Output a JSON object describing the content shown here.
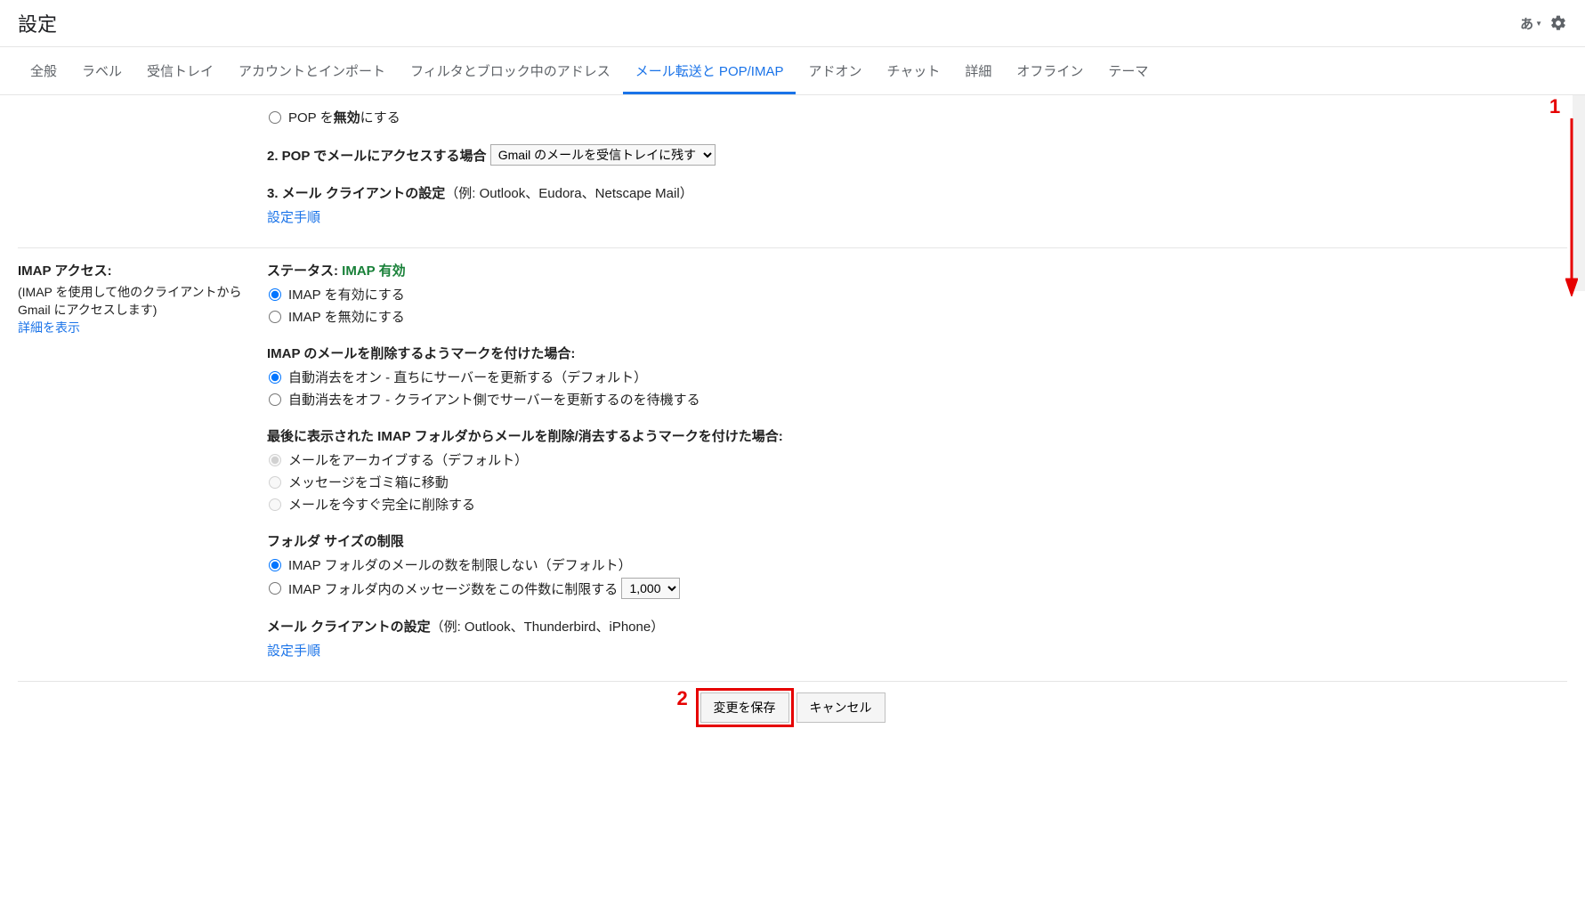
{
  "header": {
    "title": "設定",
    "language_label": "あ"
  },
  "tabs": [
    {
      "label": "全般",
      "active": false
    },
    {
      "label": "ラベル",
      "active": false
    },
    {
      "label": "受信トレイ",
      "active": false
    },
    {
      "label": "アカウントとインポート",
      "active": false
    },
    {
      "label": "フィルタとブロック中のアドレス",
      "active": false
    },
    {
      "label": "メール転送と POP/IMAP",
      "active": true
    },
    {
      "label": "アドオン",
      "active": false
    },
    {
      "label": "チャット",
      "active": false
    },
    {
      "label": "詳細",
      "active": false
    },
    {
      "label": "オフライン",
      "active": false
    },
    {
      "label": "テーマ",
      "active": false
    }
  ],
  "pop": {
    "disable_prefix": "POP を",
    "disable_bold": "無効",
    "disable_suffix": "にする",
    "step2_label": "2. POP でメールにアクセスする場合",
    "step2_select": "Gmail のメールを受信トレイに残す",
    "step3_label": "3. メール クライアントの設定",
    "step3_example": "（例: Outlook、Eudora、Netscape Mail）",
    "setup_link": "設定手順"
  },
  "imap": {
    "left_title": "IMAP アクセス:",
    "left_desc": "(IMAP を使用して他のクライアントから Gmail にアクセスします)",
    "left_link": "詳細を表示",
    "status_label": "ステータス:",
    "status_value": "IMAP 有効",
    "enable_label": "IMAP を有効にする",
    "disable_label": "IMAP を無効にする",
    "delete_mark_title": "IMAP のメールを削除するようマークを付けた場合:",
    "auto_expunge_on": "自動消去をオン - 直ちにサーバーを更新する（デフォルト）",
    "auto_expunge_off": "自動消去をオフ - クライアント側でサーバーを更新するのを待機する",
    "last_folder_title": "最後に表示された IMAP フォルダからメールを削除/消去するようマークを付けた場合:",
    "archive_label": "メールをアーカイブする（デフォルト）",
    "trash_label": "メッセージをゴミ箱に移動",
    "delete_now_label": "メールを今すぐ完全に削除する",
    "folder_size_title": "フォルダ サイズの制限",
    "folder_no_limit": "IMAP フォルダのメールの数を制限しない（デフォルト）",
    "folder_limit_prefix": "IMAP フォルダ内のメッセージ数をこの件数に制限する",
    "folder_limit_value": "1,000",
    "client_setup_label": "メール クライアントの設定",
    "client_setup_example": "（例: Outlook、Thunderbird、iPhone）",
    "setup_link": "設定手順"
  },
  "buttons": {
    "save": "変更を保存",
    "cancel": "キャンセル"
  },
  "annotations": {
    "num1": "1",
    "num2": "2"
  }
}
